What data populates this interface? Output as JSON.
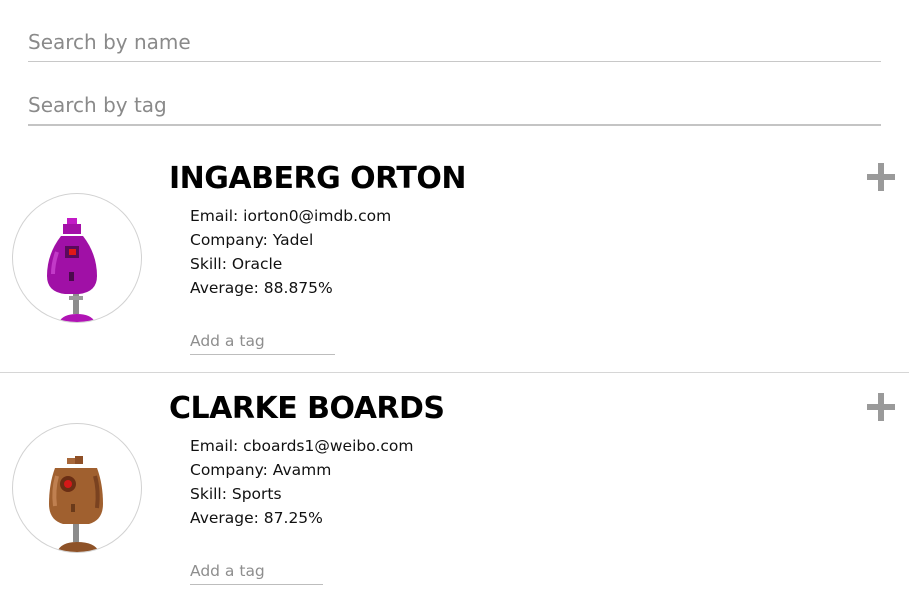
{
  "search": {
    "name_placeholder": "Search by name",
    "tag_placeholder": "Search by tag"
  },
  "students": [
    {
      "name": "INGABERG ORTON",
      "email": "Email: iorton0@imdb.com",
      "company": "Company: Yadel",
      "skill": "Skill: Oracle",
      "average": "Average: 88.875%",
      "tag_placeholder": "Add a tag",
      "avatar_icon": "robot-purple-icon",
      "avatar_color": "#a410a8"
    },
    {
      "name": "CLARKE BOARDS",
      "email": "Email: cboards1@weibo.com",
      "company": "Company: Avamm",
      "skill": "Skill: Sports",
      "average": "Average: 87.25%",
      "tag_placeholder": "Add a tag",
      "avatar_icon": "robot-brown-icon",
      "avatar_color": "#9b5a2e"
    }
  ],
  "expand_icon": "plus-icon",
  "colors": {
    "expand_icon": "#9a9a9a",
    "divider": "#d6d6d6"
  }
}
